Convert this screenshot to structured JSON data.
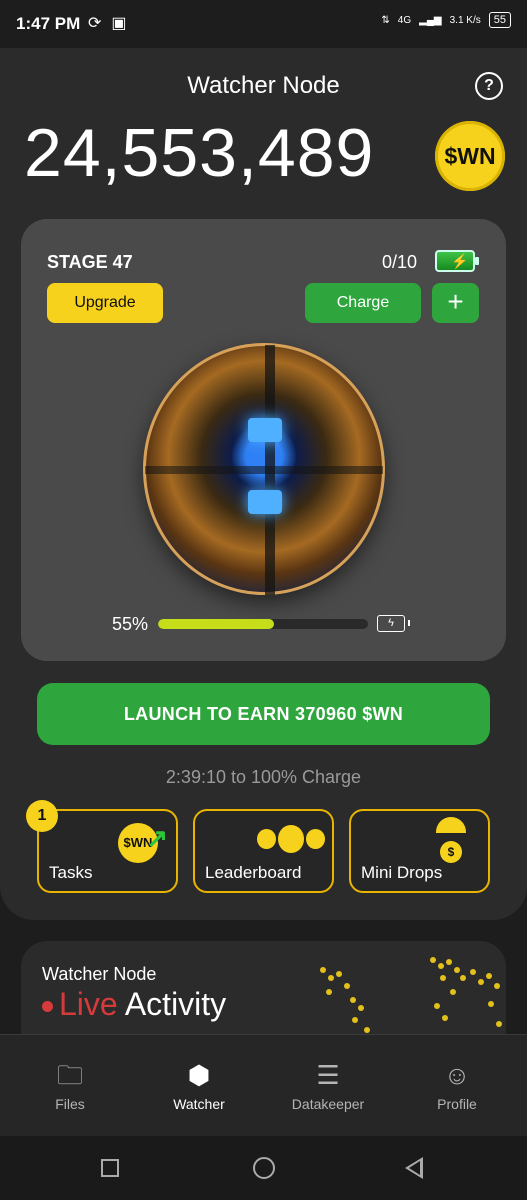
{
  "status_bar": {
    "time": "1:47 PM",
    "network": "4G",
    "speed": "3.1 K/s",
    "battery": "55"
  },
  "header": {
    "title": "Watcher Node",
    "balance": "24,553,489",
    "coin_label": "$WN"
  },
  "node": {
    "stage": "STAGE 47",
    "charges": "0/10",
    "upgrade_label": "Upgrade",
    "charge_label": "Charge",
    "plus_label": "+",
    "progress_label": "55%",
    "progress_value": 0.55
  },
  "launch": {
    "label": "LAUNCH TO EARN 370960 $WN",
    "countdown": "2:39:10 to 100% Charge"
  },
  "cards": [
    {
      "label": "Tasks",
      "badge": "1",
      "coin": "$WN"
    },
    {
      "label": "Leaderboard"
    },
    {
      "label": "Mini Drops",
      "coin": "$"
    }
  ],
  "activity": {
    "title": "Watcher Node",
    "live_word": "Live",
    "rest": "Activity"
  },
  "bottom_nav": [
    {
      "label": "Files"
    },
    {
      "label": "Watcher"
    },
    {
      "label": "Datakeeper"
    },
    {
      "label": "Profile"
    }
  ],
  "colors": {
    "accent_yellow": "#f7d21c",
    "accent_green": "#2ea63d",
    "live_red": "#d63b3b",
    "progress": "#c6de1a"
  }
}
